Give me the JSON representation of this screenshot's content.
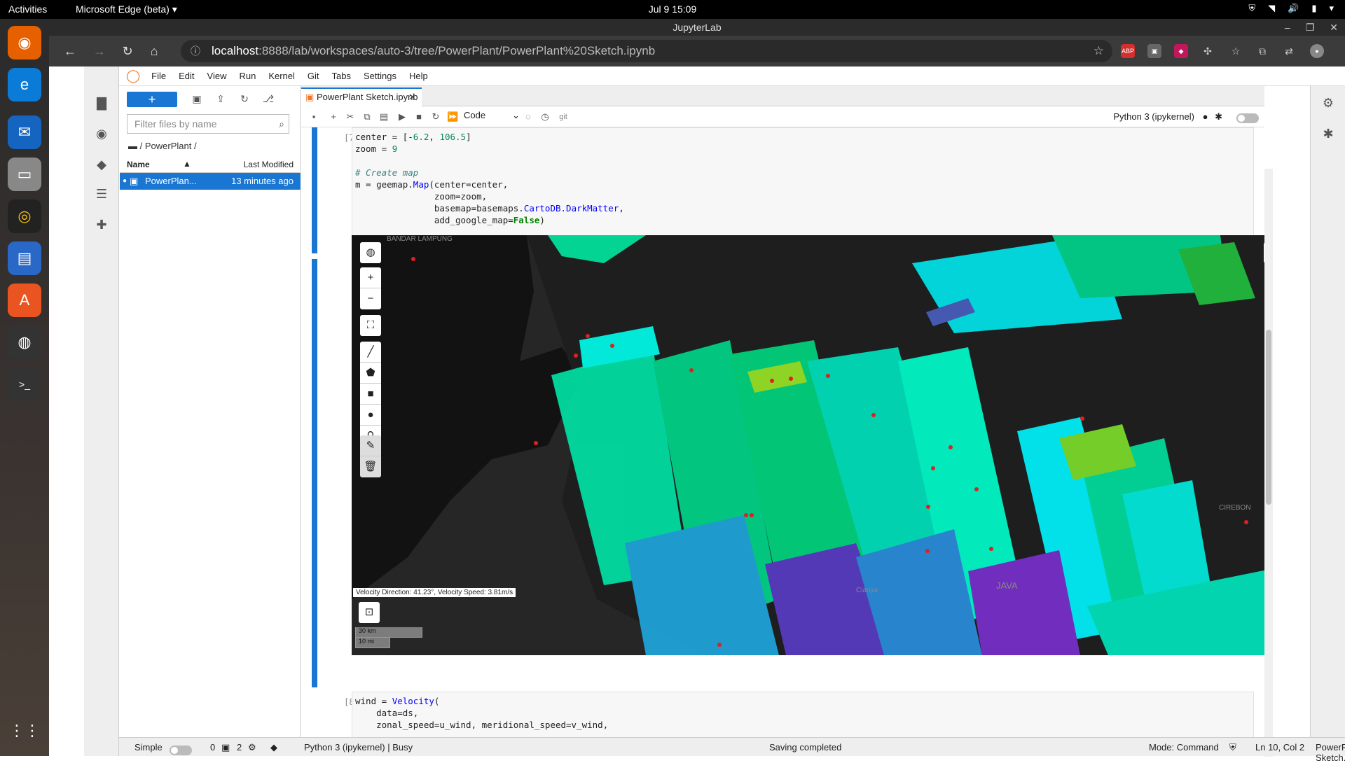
{
  "topbar": {
    "activities": "Activities",
    "app": "Microsoft Edge (beta)",
    "clock": "Jul 9  15:09"
  },
  "browser": {
    "title": "JupyterLab",
    "url_host": "localhost",
    "url_path": ":8888/lab/workspaces/auto-3/tree/PowerPlant/PowerPlant%20Sketch.ipynb",
    "extensions": [
      "ABP"
    ]
  },
  "jlab": {
    "menu": [
      "File",
      "Edit",
      "View",
      "Run",
      "Kernel",
      "Git",
      "Tabs",
      "Settings",
      "Help"
    ],
    "filebrowser": {
      "filter_placeholder": "Filter files by name",
      "breadcrumb": "/ PowerPlant /",
      "col_name": "Name",
      "col_modified": "Last Modified",
      "rows": [
        {
          "name": "PowerPlan...",
          "modified": "13 minutes ago"
        }
      ]
    },
    "tab": {
      "label": "PowerPlant Sketch.ipynb"
    },
    "toolbar": {
      "cell_type": "Code",
      "git_label": "git",
      "kernel": "Python 3 (ipykernel)"
    },
    "cells": [
      {
        "prompt": "[7]:"
      },
      {
        "prompt": "[8]:"
      }
    ],
    "map": {
      "velocity_info": "Velocity Direction: 41.23°, Velocity Speed: 3.81m/s",
      "scale_km": "30 km",
      "scale_mi": "10 mi",
      "place_labels": [
        "BANDAR LAMPUNG",
        "Cianjur",
        "JAVA",
        "CIREBON"
      ]
    },
    "status": {
      "mode_simple": "Simple",
      "count_a": "0",
      "count_b": "2",
      "kernel_status": "Python 3 (ipykernel) | Busy",
      "saving": "Saving completed",
      "mode": "Mode: Command",
      "position": "Ln 10, Col 2",
      "file": "PowerPlant Sketch.ipynb"
    }
  }
}
